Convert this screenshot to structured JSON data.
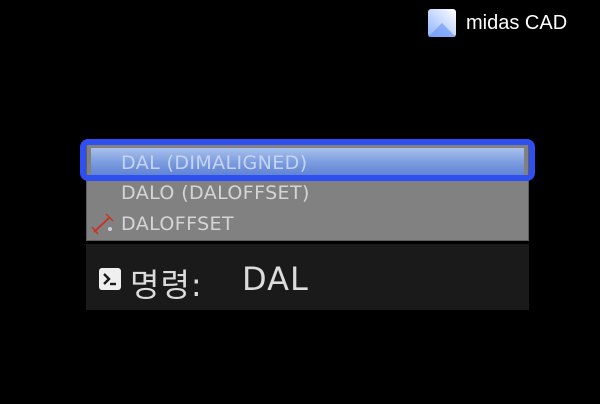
{
  "brand": {
    "name": "midas CAD",
    "logo_icon": "midas-logo-icon"
  },
  "autocomplete": {
    "items": [
      {
        "label": "DAL (DIMALIGNED)",
        "selected": true,
        "icon": ""
      },
      {
        "label": "DALO (DALOFFSET)",
        "selected": false,
        "icon": ""
      },
      {
        "label": "DALOFFSET",
        "selected": false,
        "icon": "aligned-dimension-icon"
      }
    ]
  },
  "command_line": {
    "prompt_icon": "command-prompt-icon",
    "label": "명령:",
    "value": "DAL"
  },
  "colors": {
    "highlight": "#2f4ff0",
    "selected_item_top": "#a9c0ec",
    "selected_item_bottom": "#5b7ed2",
    "list_background": "#818181",
    "command_background": "#1a1a1a",
    "page_background": "#000000"
  }
}
